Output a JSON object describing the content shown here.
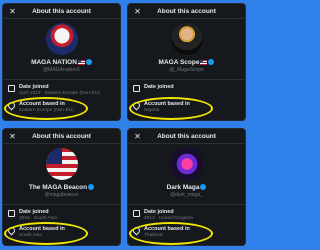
{
  "cards": [
    {
      "title": "About this account",
      "display_name": "MAGA NATION",
      "handle": "@MAGAnationX",
      "date_label": "Date joined",
      "date_value": "April 2013 · Eastern Europe (Non-EU)",
      "location_label": "Account based in",
      "location_value": "Eastern Europe (Non-EU)"
    },
    {
      "title": "About this account",
      "display_name": "MAGA Scope",
      "handle": "@_MagaScope",
      "date_label": "Date joined",
      "date_value": "",
      "location_label": "Account based in",
      "location_value": "Nigeria"
    },
    {
      "title": "About this account",
      "display_name": "The MAGA Beacon",
      "handle": "@magabeacon",
      "date_label": "Date joined",
      "date_value": "2016 · South Asia",
      "location_label": "Account based in",
      "location_value": "South Asia"
    },
    {
      "title": "About this account",
      "display_name": "Dark Maga",
      "handle": "@dark_maga_",
      "date_label": "Date joined",
      "date_value": "2013 · United Kingdom",
      "location_label": "Account based in",
      "location_value": "Thailand"
    }
  ],
  "colors": {
    "background": "#2f80e8",
    "card": "#15181c",
    "highlight": "#f2e600",
    "verified": "#1d9bf0"
  },
  "icons": [
    "close-icon",
    "verified-badge-icon",
    "us-flag-icon",
    "calendar-icon",
    "location-pin-icon"
  ]
}
